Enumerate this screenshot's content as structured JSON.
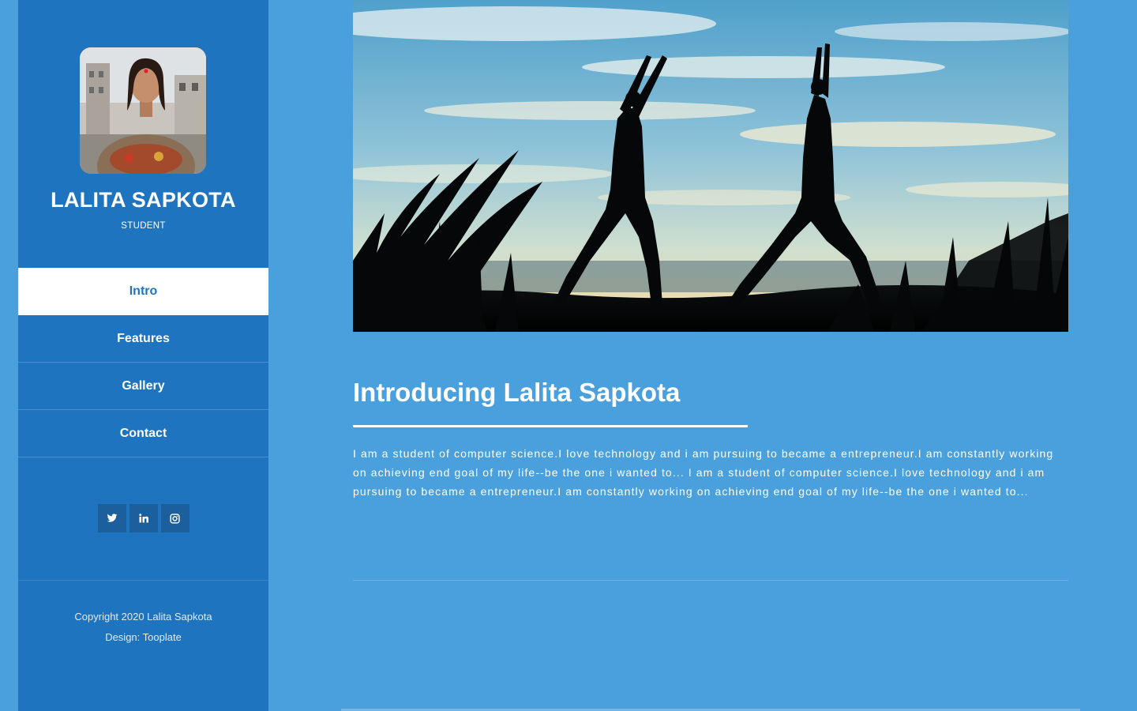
{
  "profile": {
    "name": "LALITA SAPKOTA",
    "role": "STUDENT"
  },
  "nav": {
    "items": [
      {
        "label": "Intro",
        "active": true
      },
      {
        "label": "Features",
        "active": false
      },
      {
        "label": "Gallery",
        "active": false
      },
      {
        "label": "Contact",
        "active": false
      }
    ]
  },
  "social": {
    "icons": [
      "twitter-icon",
      "linkedin-icon",
      "instagram-icon"
    ]
  },
  "footer": {
    "copyright": "Copyright 2020 Lalita Sapkota",
    "design_prefix": "Design: ",
    "design_link": "Tooplate"
  },
  "main": {
    "title": "Introducing Lalita Sapkota",
    "paragraph": "I am a student of computer science.I love technology and i am pursuing to became a entrepreneur.I am constantly working on achieving end goal of my life--be the one i wanted to... I am a student of computer science.I love technology and i am pursuing to became a entrepreneur.I am constantly working on achieving end goal of my life--be the one i wanted to..."
  },
  "colors": {
    "page_background": "#4a9fdd",
    "sidebar_background": "#1f74bf",
    "social_button": "#1b5f9c",
    "active_nav_background": "#ffffff"
  }
}
